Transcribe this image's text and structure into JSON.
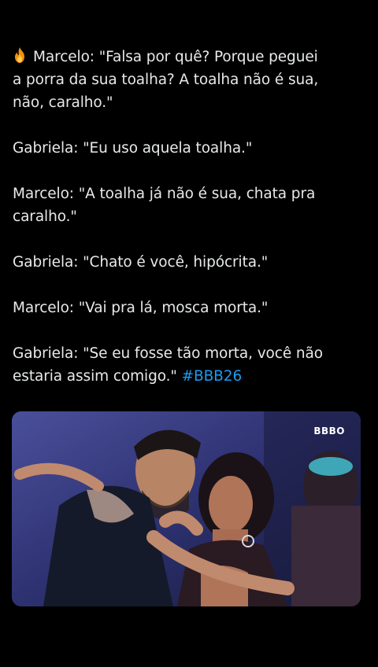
{
  "post": {
    "lines": [
      {
        "text": "Marcelo: \"Falsa por quê? Porque peguei"
      },
      {
        "text": "a porra da sua toalha? A toalha não é sua,"
      },
      {
        "text": "não, caralho.\""
      },
      {
        "text": ""
      },
      {
        "text": "Gabriela: \"Eu uso aquela toalha.\""
      },
      {
        "text": ""
      },
      {
        "text": "Marcelo: \"A toalha já não é sua, chata pra"
      },
      {
        "text": "caralho.\""
      },
      {
        "text": ""
      },
      {
        "text": "Gabriela: \"Chato é você, hipócrita.\""
      },
      {
        "text": ""
      },
      {
        "text": "Marcelo: \"Vai pra lá, mosca morta.\""
      },
      {
        "text": ""
      },
      {
        "text": "Gabriela: \"Se eu fosse tão morta, você não"
      }
    ],
    "last_line": "estaria assim comigo.\" ",
    "hashtag": "#BBB26",
    "leading_icon": "fire-emoji"
  },
  "media": {
    "logo_text": "BBBO",
    "description_icon": "video-still"
  },
  "colors": {
    "background": "#000000",
    "text": "#e7e9ea",
    "hashtag": "#1d9bf0"
  }
}
